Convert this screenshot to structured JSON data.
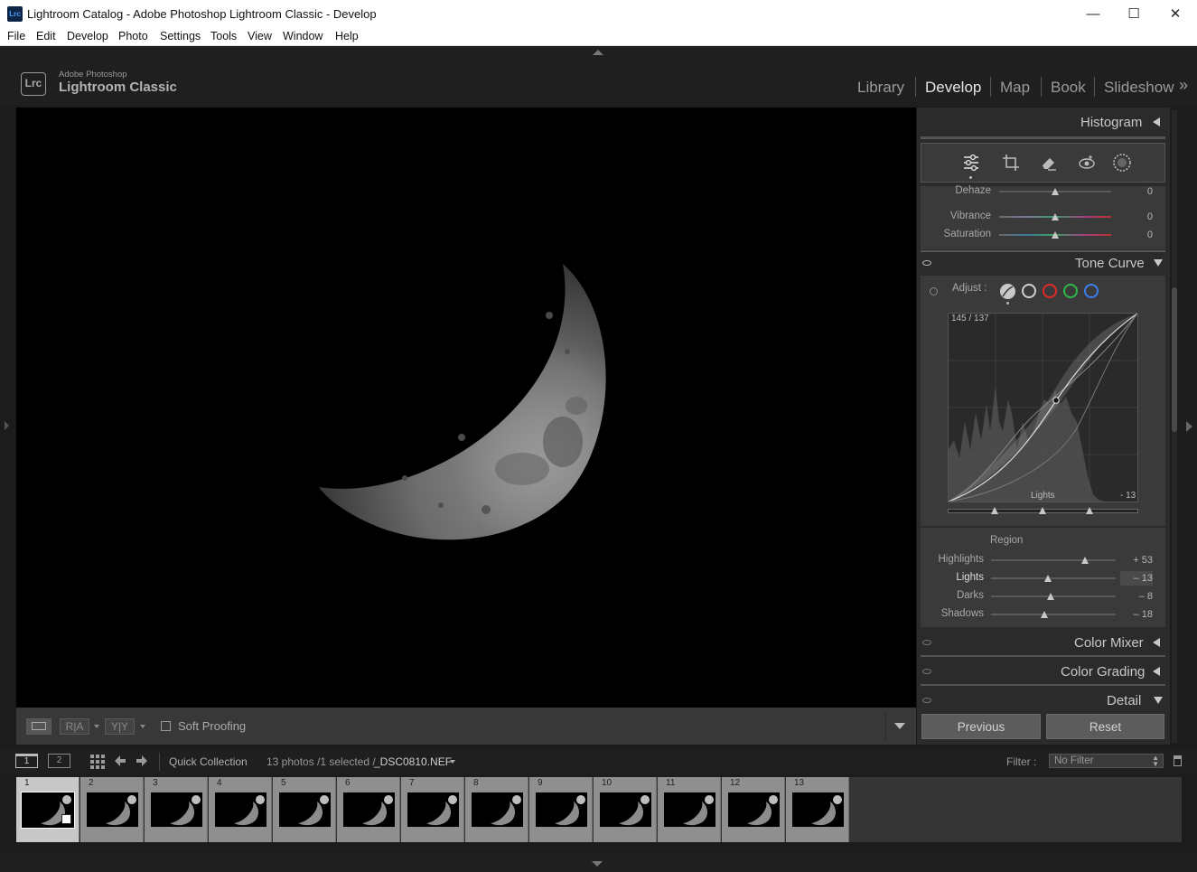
{
  "window": {
    "app_icon": "Lrc",
    "title": "Lightroom Catalog - Adobe Photoshop Lightroom Classic - Develop",
    "minimize": "—",
    "maximize": "☐",
    "close": "✕"
  },
  "menu": [
    "File",
    "Edit",
    "Develop",
    "Photo",
    "Settings",
    "Tools",
    "View",
    "Window",
    "Help"
  ],
  "brand": {
    "logo": "Lrc",
    "line1": "Adobe Photoshop",
    "line2": "Lightroom Classic"
  },
  "modules": [
    "Library",
    "Develop",
    "Map",
    "Book",
    "Slideshow"
  ],
  "active_module": "Develop",
  "more_modules": "»",
  "right_panel": {
    "histogram_title": "Histogram",
    "tools": [
      "sliders-icon",
      "crop-icon",
      "eraser-icon",
      "redeye-icon",
      "masking-icon"
    ],
    "presence": [
      {
        "label": "Dehaze",
        "value": "0",
        "fraction": 0.5
      },
      {
        "label": "Vibrance",
        "value": "0",
        "fraction": 0.5
      },
      {
        "label": "Saturation",
        "value": "0",
        "fraction": 0.5
      }
    ],
    "tone_curve": {
      "title": "Tone Curve",
      "adjust_label": "Adjust :",
      "readout": "145 / 137",
      "region_hover": "Lights",
      "region_hover_value": "- 13",
      "channels": [
        {
          "name": "parametric",
          "color": "#bcbcbc"
        },
        {
          "name": "point",
          "color": "#cfcfcf"
        },
        {
          "name": "red",
          "color": "#e02a2a"
        },
        {
          "name": "green",
          "color": "#2fb84a"
        },
        {
          "name": "blue",
          "color": "#3a7ef0"
        }
      ],
      "split_points": [
        0.25,
        0.5,
        0.75
      ],
      "region_title": "Region",
      "region": [
        {
          "label": "Highlights",
          "value": "+ 53",
          "fraction": 0.765
        },
        {
          "label": "Lights",
          "value": "– 13",
          "fraction": 0.435
        },
        {
          "label": "Darks",
          "value": "– 8",
          "fraction": 0.46
        },
        {
          "label": "Shadows",
          "value": "– 18",
          "fraction": 0.41
        }
      ]
    },
    "collapsed_sections": [
      "Color Mixer",
      "Color Grading",
      "Detail"
    ],
    "previous_label": "Previous",
    "reset_label": "Reset"
  },
  "toolbar": {
    "view_mode": "loupe-icon",
    "ra_label": "R|A",
    "yy_label": "Y|Y",
    "soft_proofing": "Soft Proofing",
    "soft_proofing_checked": false
  },
  "filmstrip_bar": {
    "window1": "1",
    "window2": "2",
    "source": "Quick Collection",
    "count": "13 photos /1 selected /",
    "filename": "_DSC0810.NEF",
    "filter_label": "Filter :",
    "filter_value": "No Filter"
  },
  "filmstrip": {
    "numbers": [
      "1",
      "2",
      "3",
      "4",
      "5",
      "6",
      "7",
      "8",
      "9",
      "10",
      "11",
      "12",
      "13"
    ],
    "selected_index": 0
  }
}
